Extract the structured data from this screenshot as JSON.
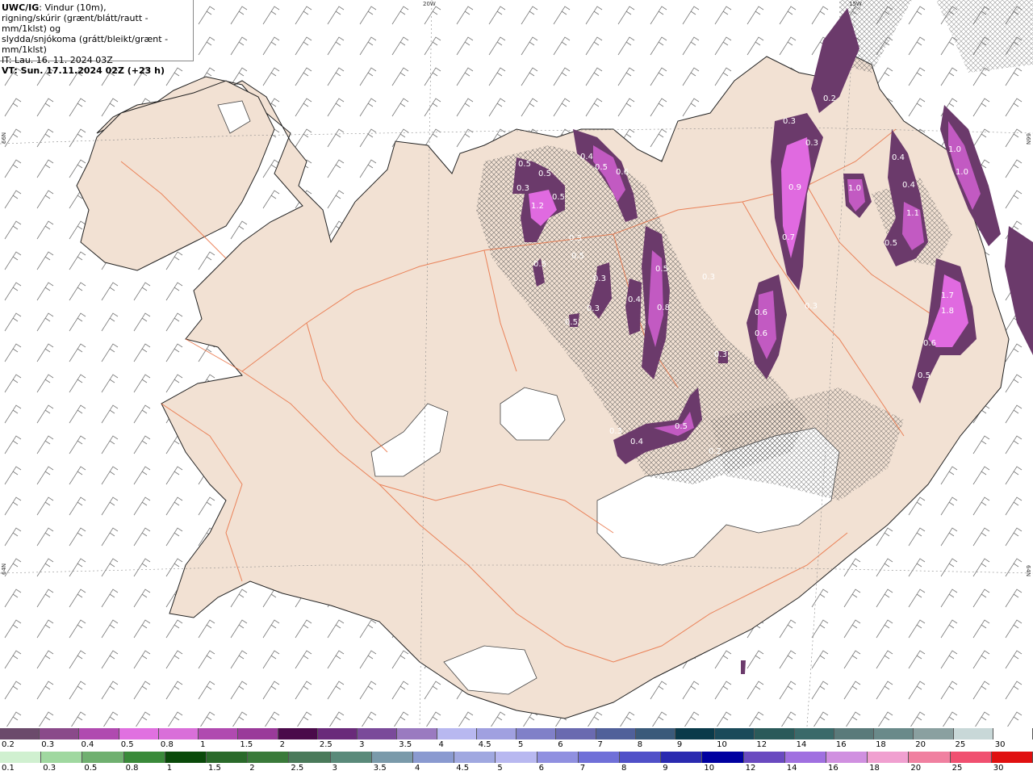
{
  "header": {
    "line1_bold": "UWC/IG",
    "line1_rest": ": Vindur (10m),",
    "line2": "rigning/skúrir (grænt/blátt/rautt - mm/1klst) og",
    "line3": "slydda/snjókoma (grátt/bleikt/grænt - mm/1klst)",
    "line4": "IT: Lau. 16. 11. 2024 03Z",
    "line5": "VT: Sun. 17.11.2024 02Z (+23 h)"
  },
  "grid_labels": {
    "top_20w": "20W",
    "top_15w": "15W",
    "left_66n": "66N",
    "left_64n": "64N",
    "right_66n": "66N",
    "right_64n": "64N"
  },
  "precip_values": [
    "0.2",
    "0.3",
    "0.5",
    "0.3",
    "0.5",
    "1.2",
    "0.5",
    "0.4",
    "0.5",
    "0.6",
    "0.3",
    "0.3",
    "0.5",
    "0.5",
    "0.3",
    "0.5",
    "0.4",
    "0.8",
    "0.3",
    "0.3",
    "0.3",
    "0.5",
    "0.9",
    "0.7",
    "1.0",
    "0.6",
    "0.6",
    "0.3",
    "0.2",
    "0.3",
    "0.4",
    "0.5",
    "0.4",
    "0.4",
    "1.1",
    "0.5",
    "1.0",
    "1.0",
    "1.7",
    "1.8",
    "0.6",
    "0.5"
  ],
  "legend_snow": {
    "labels": [
      "0.2",
      "0.3",
      "0.4",
      "0.5",
      "0.8",
      "1",
      "1.5",
      "2",
      "2.5",
      "3",
      "3.5",
      "4",
      "4.5",
      "5",
      "6",
      "7",
      "8",
      "9",
      "10",
      "12",
      "14",
      "16",
      "18",
      "20",
      "25",
      "30"
    ],
    "colors": [
      "#6b4a6b",
      "#8a4a8a",
      "#b04ab0",
      "#e070e0",
      "#d96fd9",
      "#b04ab0",
      "#9a3a9a",
      "#4a0a4a",
      "#6a2a7a",
      "#7a4a9a",
      "#9a7ac0",
      "#b8b8f0",
      "#a0a0e0",
      "#8080c8",
      "#6a6ab0",
      "#50609a",
      "#3a5a7a",
      "#0a3a4a",
      "#1a4a5a",
      "#2a5a5a",
      "#3a6a6a",
      "#5a7a7a",
      "#6a8a8a",
      "#8aa0a0",
      "#c8d8d8",
      "#ffffff"
    ]
  },
  "legend_rain": {
    "labels": [
      "0.1",
      "0.3",
      "0.5",
      "0.8",
      "1",
      "1.5",
      "2",
      "2.5",
      "3",
      "3.5",
      "4",
      "4.5",
      "5",
      "6",
      "7",
      "8",
      "9",
      "10",
      "12",
      "14",
      "16",
      "18",
      "20",
      "25",
      "30"
    ],
    "colors": [
      "#d0f0d0",
      "#a0d8a0",
      "#70b070",
      "#3a8a3a",
      "#0a4a0a",
      "#2a6a2a",
      "#3a7a3a",
      "#4a7a5a",
      "#5a8a7a",
      "#7a9aaa",
      "#8a9ad0",
      "#a0a8e0",
      "#b8b8f0",
      "#9090e0",
      "#7070d8",
      "#5050c8",
      "#2a2ab0",
      "#0000a0",
      "#6a4ac0",
      "#a070e0",
      "#d090e0",
      "#f0a0d0",
      "#f080a0",
      "#f05070",
      "#e01010"
    ]
  }
}
